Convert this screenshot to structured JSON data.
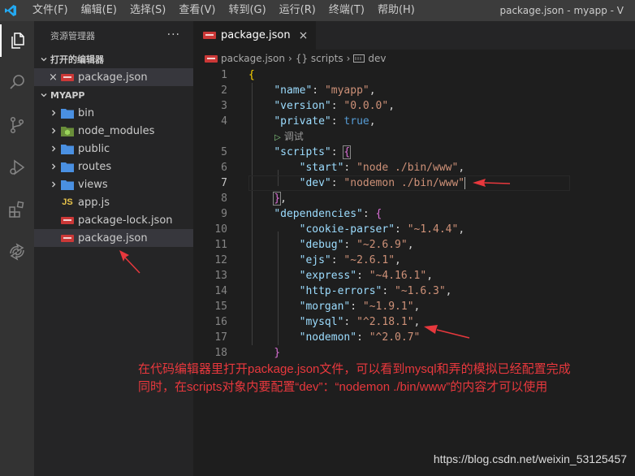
{
  "titlebar": {
    "menu": [
      "文件(F)",
      "编辑(E)",
      "选择(S)",
      "查看(V)",
      "转到(G)",
      "运行(R)",
      "终端(T)",
      "帮助(H)"
    ],
    "window_title": "package.json - myapp - V"
  },
  "activitybar": {
    "icons": [
      "files-icon",
      "search-icon",
      "source-control-icon",
      "run-debug-icon",
      "extensions-icon",
      "remote-icon"
    ]
  },
  "sidebar": {
    "title": "资源管理器",
    "more": "···",
    "open_editors": {
      "label": "打开的编辑器",
      "items": [
        {
          "close": "×",
          "name": "package.json"
        }
      ]
    },
    "project": {
      "label": "MYAPP",
      "items": [
        {
          "name": "bin",
          "kind": "folder"
        },
        {
          "name": "node_modules",
          "kind": "node-folder"
        },
        {
          "name": "public",
          "kind": "folder"
        },
        {
          "name": "routes",
          "kind": "folder"
        },
        {
          "name": "views",
          "kind": "folder"
        },
        {
          "name": "app.js",
          "kind": "js"
        },
        {
          "name": "package-lock.json",
          "kind": "npm"
        },
        {
          "name": "package.json",
          "kind": "npm",
          "selected": true
        }
      ]
    }
  },
  "editor": {
    "tab": {
      "name": "package.json",
      "close": "×"
    },
    "breadcrumb": {
      "file": "package.json",
      "obj": "{} scripts",
      "key": "dev"
    },
    "codelens": "调试",
    "line_numbers": [
      "1",
      "2",
      "3",
      "4",
      "5",
      "6",
      "7",
      "8",
      "9",
      "10",
      "11",
      "12",
      "13",
      "14",
      "15",
      "16",
      "17",
      "18"
    ],
    "current_line": 7
  },
  "code": {
    "open_brace": "{",
    "name_key": "\"name\"",
    "name_val": "\"myapp\"",
    "version_key": "\"version\"",
    "version_val": "\"0.0.0\"",
    "private_key": "\"private\"",
    "private_val": "true",
    "scripts_key": "\"scripts\"",
    "start_key": "\"start\"",
    "start_val": "\"node ./bin/www\"",
    "dev_key": "\"dev\"",
    "dev_val": "\"nodemon ./bin/www\"",
    "deps_key": "\"dependencies\"",
    "deps": [
      {
        "k": "\"cookie-parser\"",
        "v": "\"~1.4.4\""
      },
      {
        "k": "\"debug\"",
        "v": "\"~2.6.9\""
      },
      {
        "k": "\"ejs\"",
        "v": "\"~2.6.1\""
      },
      {
        "k": "\"express\"",
        "v": "\"~4.16.1\""
      },
      {
        "k": "\"http-errors\"",
        "v": "\"~1.6.3\""
      },
      {
        "k": "\"morgan\"",
        "v": "\"~1.9.1\""
      },
      {
        "k": "\"mysql\"",
        "v": "\"^2.18.1\""
      },
      {
        "k": "\"nodemon\"",
        "v": "\"^2.0.7\""
      }
    ],
    "close_brace": "}"
  },
  "annotation": {
    "line1": "在代码编辑器里打开package.json文件，可以看到mysql和弄的模拟已经配置完成",
    "line2": "同时，在scripts对象内要配置“dev”：“nodemon ./bin/www”的内容才可以使用",
    "color": "#e8383d"
  },
  "watermark": "https://blog.csdn.net/weixin_53125457"
}
